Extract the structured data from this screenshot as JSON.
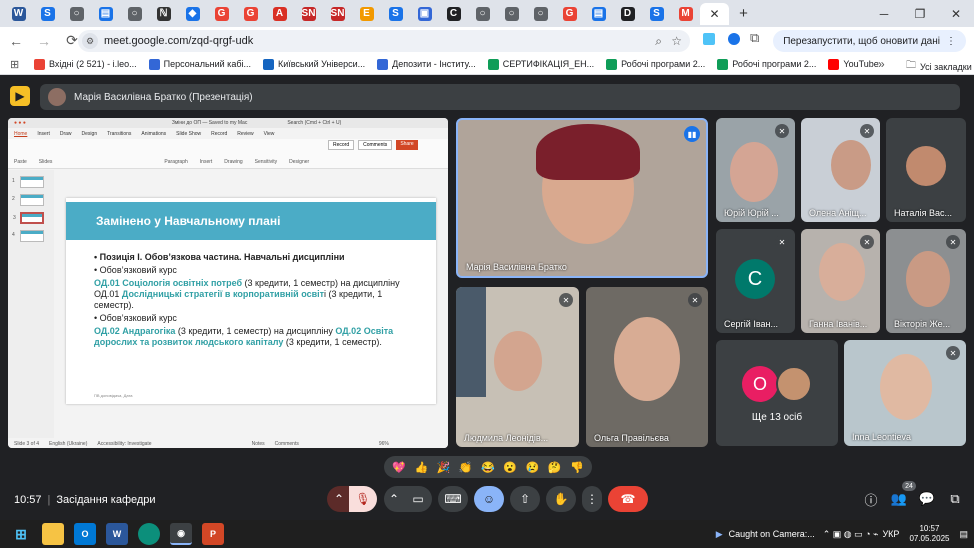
{
  "browser": {
    "tabs": [
      {
        "icon": "W",
        "color": "#2b579a"
      },
      {
        "icon": "S",
        "color": "#1a73e8"
      },
      {
        "icon": "○",
        "color": "#5f6368"
      },
      {
        "icon": "▤",
        "color": "#1a73e8"
      },
      {
        "icon": "○",
        "color": "#5f6368"
      },
      {
        "icon": "ℕ",
        "color": "#333"
      },
      {
        "icon": "◆",
        "color": "#1a73e8"
      },
      {
        "icon": "G",
        "color": "#ea4335"
      },
      {
        "icon": "G",
        "color": "#ea4335"
      },
      {
        "icon": "A",
        "color": "#d93025"
      },
      {
        "icon": "SN",
        "color": "#c62828"
      },
      {
        "icon": "SN",
        "color": "#c62828"
      },
      {
        "icon": "E",
        "color": "#f29900"
      },
      {
        "icon": "S",
        "color": "#1a73e8"
      },
      {
        "icon": "▣",
        "color": "#3367d6"
      },
      {
        "icon": "C",
        "color": "#202124"
      },
      {
        "icon": "○",
        "color": "#5f6368"
      },
      {
        "icon": "○",
        "color": "#5f6368"
      },
      {
        "icon": "○",
        "color": "#5f6368"
      },
      {
        "icon": "G",
        "color": "#ea4335"
      },
      {
        "icon": "▤",
        "color": "#1a73e8"
      },
      {
        "icon": "D",
        "color": "#202124"
      },
      {
        "icon": "S",
        "color": "#1a73e8"
      },
      {
        "icon": "M",
        "color": "#ea4335"
      }
    ],
    "active_tab_close": "✕",
    "new_tab": "+",
    "url": "meet.google.com/zqd-qrgf-udk",
    "relaunch_label": "Перезапустити, щоб оновити дані",
    "bookmarks": [
      {
        "label": "Вхідні (2 521) - i.leo...",
        "color": "#ea4335"
      },
      {
        "label": "Персональний кабі...",
        "color": "#3367d6"
      },
      {
        "label": "Київський Універси...",
        "color": "#1565c0"
      },
      {
        "label": "Депозити - Інститу...",
        "color": "#3367d6"
      },
      {
        "label": "СЕРТИФІКАЦІЯ_ЕН...",
        "color": "#0f9d58"
      },
      {
        "label": "Робочі програми 2...",
        "color": "#0f9d58"
      },
      {
        "label": "Робочі програми 2...",
        "color": "#0f9d58"
      },
      {
        "label": "YouTube",
        "color": "#ff0000"
      }
    ],
    "bookmarks_more": "»",
    "all_bookmarks": "Усі закладки"
  },
  "meet": {
    "presenter_banner": "Марія Василівна Братко (Презентація)",
    "presentation": {
      "window_title": "Зміни до ОП — Saved to my Mac",
      "search_placeholder": "Search (Cmd + Ctrl + U)",
      "menu": [
        "Home",
        "Insert",
        "Draw",
        "Design",
        "Transitions",
        "Animations",
        "Slide Show",
        "Record",
        "Review",
        "View"
      ],
      "ribbon": [
        "Paste",
        "Slides",
        "Paragraph",
        "Insert",
        "Drawing",
        "Sensitivity",
        "Designer"
      ],
      "buttons": {
        "record": "Record",
        "comments": "Comments",
        "share": "Share"
      },
      "thumb_numbers": [
        "1",
        "2",
        "3",
        "4"
      ],
      "slide": {
        "title": "Замінено у Навчальному плані",
        "line1": "Позиція І. Обов’язкова частина. Навчальні дисципліни",
        "line2": "Обов’язковий курс",
        "p1_a": "ОД.01 Соціологія освітніх потреб",
        "p1_b": " (3 кредити, 1 семестр) на дисципліну ОД.01 ",
        "p1_c": "Дослідницькі стратегії в корпоративній освіт",
        "p1_d": "і (3 кредити, 1 семестр).",
        "line3": "Обов’язковий курс",
        "p2_a": "ОД.02 Андрагогіка",
        "p2_b": " (3 кредити, 1 семестр) на дисципліну ",
        "p2_c": "ОД.02 Освіта дорослих та розвиток людського капіталу",
        "p2_d": " (3 кредити, 1 семестр).",
        "footer": "ПВ доповідача, Дата"
      },
      "status": {
        "slide": "Slide 3 of 4",
        "lang": "English (Ukraine)",
        "access": "Accessibility: Investigate",
        "notes": "Notes",
        "comments": "Comments",
        "zoom": "96%"
      }
    },
    "participants": [
      {
        "name": "Марія Василівна Братко"
      },
      {
        "name": "Юрій Юрій ..."
      },
      {
        "name": "Олена Аніщ..."
      },
      {
        "name": "Наталія Вас..."
      },
      {
        "name": "Сергій Іван...",
        "initial": "С"
      },
      {
        "name": "Ганна Іванів..."
      },
      {
        "name": "Вікторія Же..."
      },
      {
        "name": "Людмила Леонідів..."
      },
      {
        "name": "Ольга Правільєва"
      },
      {
        "name": "Inna Leontieva"
      }
    ],
    "others_tile": {
      "initial": "О",
      "label": "Ще 13 осіб"
    },
    "reactions": [
      "💖",
      "👍",
      "🎉",
      "👏",
      "😂",
      "😮",
      "😢",
      "🤔",
      "👎"
    ],
    "time": "10:57",
    "meeting_title": "Засідання кафедри",
    "people_count": "24"
  },
  "taskbar": {
    "notification": "Caught on Camera:...",
    "lang": "УКР",
    "time": "10:57",
    "date": "07.05.2025"
  }
}
